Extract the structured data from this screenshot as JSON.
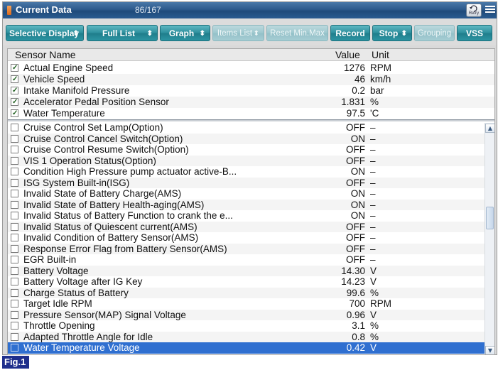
{
  "window": {
    "title": "Current Data",
    "count": "86/167",
    "retry_label": "Retry"
  },
  "toolbar": {
    "buttons": [
      {
        "label": "Selective Display",
        "has_caret": true,
        "enabled": true
      },
      {
        "label": "Full List",
        "has_caret": true,
        "enabled": true
      },
      {
        "label": "Graph",
        "has_caret": true,
        "enabled": true
      },
      {
        "label": "Items List",
        "has_caret": true,
        "enabled": false
      },
      {
        "label": "Reset Min.Max",
        "has_caret": false,
        "enabled": false
      },
      {
        "label": "Record",
        "has_caret": false,
        "enabled": true
      },
      {
        "label": "Stop",
        "has_caret": true,
        "enabled": true
      },
      {
        "label": "Grouping",
        "has_caret": false,
        "enabled": false
      },
      {
        "label": "VSS",
        "has_caret": false,
        "enabled": true
      }
    ]
  },
  "table": {
    "columns": {
      "name": "Sensor Name",
      "value": "Value",
      "unit": "Unit"
    },
    "fixed_rows": [
      {
        "name": "Actual Engine Speed",
        "value": "1276",
        "unit": "RPM",
        "checked": true
      },
      {
        "name": "Vehicle Speed",
        "value": "46",
        "unit": "km/h",
        "checked": true
      },
      {
        "name": "Intake Manifold Pressure",
        "value": "0.2",
        "unit": "bar",
        "checked": true
      },
      {
        "name": "Accelerator Pedal Position Sensor",
        "value": "1.831",
        "unit": "%",
        "checked": true
      },
      {
        "name": "Water Temperature",
        "value": "97.5",
        "unit": "'C",
        "checked": true
      }
    ],
    "rows": [
      {
        "name": "Cruise Control Set Lamp(Option)",
        "value": "OFF",
        "unit": "–",
        "checked": false
      },
      {
        "name": "Cruise Control Cancel Switch(Option)",
        "value": "ON",
        "unit": "–",
        "checked": false
      },
      {
        "name": "Cruise Control Resume Switch(Option)",
        "value": "OFF",
        "unit": "–",
        "checked": false
      },
      {
        "name": "VIS 1 Operation Status(Option)",
        "value": "OFF",
        "unit": "–",
        "checked": false
      },
      {
        "name": "Condition High Pressure pump actuator active-B...",
        "value": "ON",
        "unit": "–",
        "checked": false
      },
      {
        "name": "ISG System Built-in(ISG)",
        "value": "OFF",
        "unit": "–",
        "checked": false
      },
      {
        "name": "Invalid State of Battery Charge(AMS)",
        "value": "ON",
        "unit": "–",
        "checked": false
      },
      {
        "name": "Invalid State of Battery Health-aging(AMS)",
        "value": "ON",
        "unit": "–",
        "checked": false
      },
      {
        "name": "Invalid Status of Battery Function to crank the e...",
        "value": "ON",
        "unit": "–",
        "checked": false
      },
      {
        "name": "Invalid Status of Quiescent current(AMS)",
        "value": "OFF",
        "unit": "–",
        "checked": false
      },
      {
        "name": "Invalid Condition of Battery Sensor(AMS)",
        "value": "OFF",
        "unit": "–",
        "checked": false
      },
      {
        "name": "Response Error Flag from Battery Sensor(AMS)",
        "value": "OFF",
        "unit": "–",
        "checked": false
      },
      {
        "name": "EGR Built-in",
        "value": "OFF",
        "unit": "–",
        "checked": false
      },
      {
        "name": "Battery Voltage",
        "value": "14.30",
        "unit": "V",
        "checked": false
      },
      {
        "name": "Battery Voltage after IG Key",
        "value": "14.23",
        "unit": "V",
        "checked": false
      },
      {
        "name": "Charge Status of Battery",
        "value": "99.6",
        "unit": "%",
        "checked": false
      },
      {
        "name": "Target Idle RPM",
        "value": "700",
        "unit": "RPM",
        "checked": false
      },
      {
        "name": "Pressure Sensor(MAP) Signal Voltage",
        "value": "0.96",
        "unit": "V",
        "checked": false
      },
      {
        "name": "Throttle Opening",
        "value": "3.1",
        "unit": "%",
        "checked": false
      },
      {
        "name": "Adapted Throttle Angle for Idle",
        "value": "0.8",
        "unit": "%",
        "checked": false
      },
      {
        "name": "Water Temperature Voltage",
        "value": "0.42",
        "unit": "V",
        "checked": false,
        "selected": true
      }
    ]
  },
  "figure_label": "Fig.1",
  "colors": {
    "titlebar": "#2d5a8c",
    "button": "#2b8e9c",
    "selection": "#2f6fd0",
    "figure_label_bg": "#1f2f8c"
  }
}
